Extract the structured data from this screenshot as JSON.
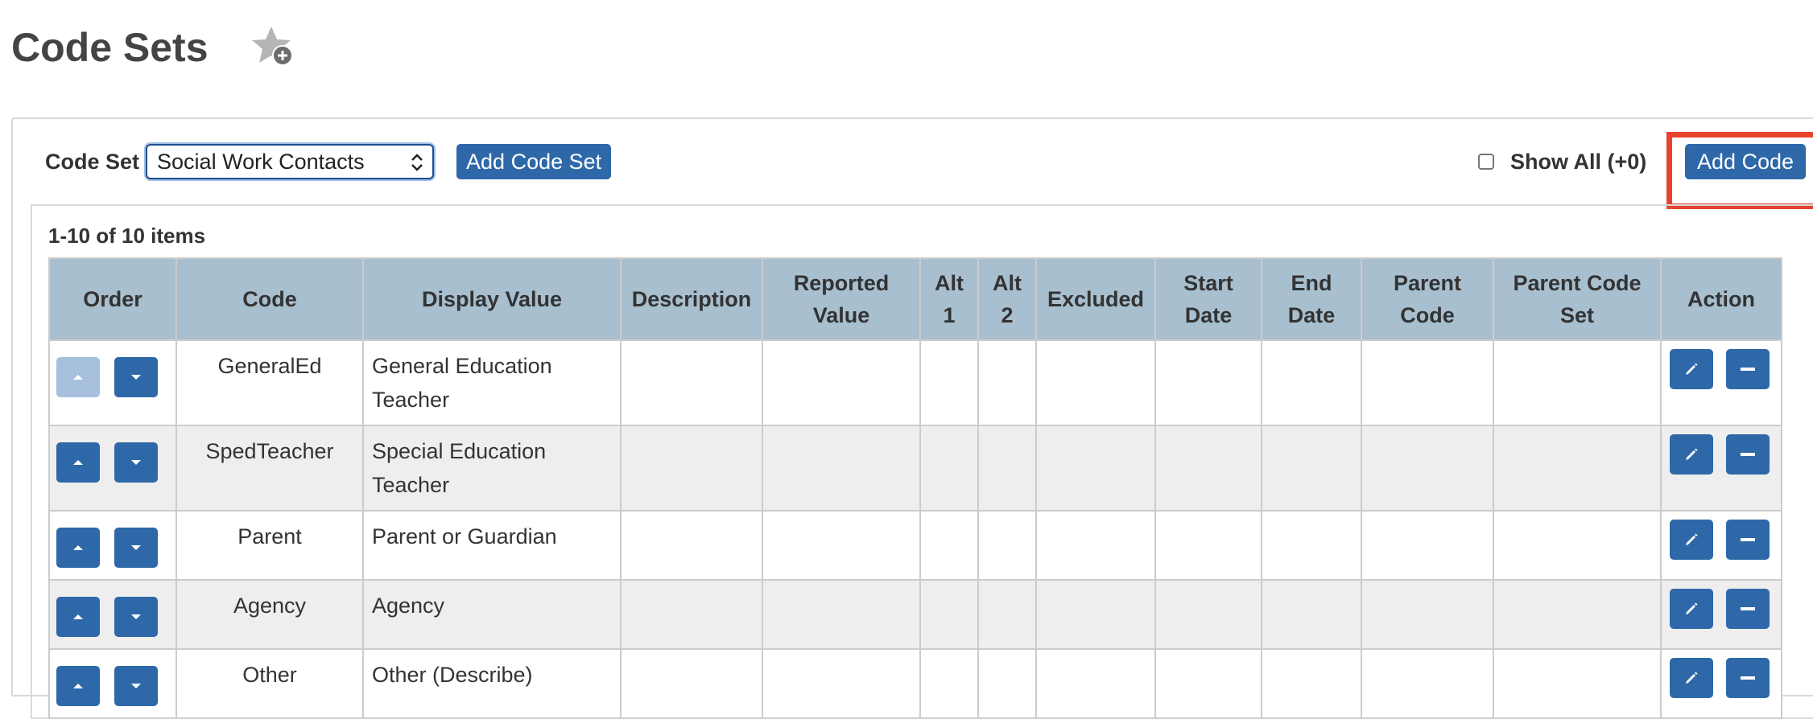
{
  "header": {
    "title": "Code Sets",
    "favorite_icon": "star-add-icon"
  },
  "toolbar": {
    "code_set_label": "Code Set",
    "code_set_selected": "Social Work Contacts",
    "add_code_set_label": "Add Code Set",
    "show_all_label": "Show All (+0)",
    "show_all_checked": false,
    "add_code_label": "Add Code"
  },
  "grid": {
    "pager": "1-10 of 10 items",
    "columns": {
      "order": "Order",
      "code": "Code",
      "display_value": "Display Value",
      "description": "Description",
      "reported_value_1": "Reported",
      "reported_value_2": "Value",
      "alt1_1": "Alt",
      "alt1_2": "1",
      "alt2_1": "Alt",
      "alt2_2": "2",
      "excluded": "Excluded",
      "start_date_1": "Start",
      "start_date_2": "Date",
      "end_date_1": "End",
      "end_date_2": "Date",
      "parent_code_1": "Parent",
      "parent_code_2": "Code",
      "parent_code_set_1": "Parent Code",
      "parent_code_set_2": "Set",
      "action": "Action"
    },
    "rows": [
      {
        "code": "GeneralEd",
        "display_1": "General Education",
        "display_2": "Teacher",
        "up_disabled": true
      },
      {
        "code": "SpedTeacher",
        "display_1": "Special Education",
        "display_2": "Teacher",
        "up_disabled": false
      },
      {
        "code": "Parent",
        "display_1": "Parent or Guardian",
        "display_2": "",
        "up_disabled": false
      },
      {
        "code": "Agency",
        "display_1": "Agency",
        "display_2": "",
        "up_disabled": false
      },
      {
        "code": "Other",
        "display_1": "Other (Describe)",
        "display_2": "",
        "up_disabled": false
      }
    ]
  },
  "colors": {
    "accent": "#2e68a8",
    "accent_disabled": "#a6c0dd",
    "header_bg": "#a8bfcf",
    "highlight": "#e8432d"
  }
}
